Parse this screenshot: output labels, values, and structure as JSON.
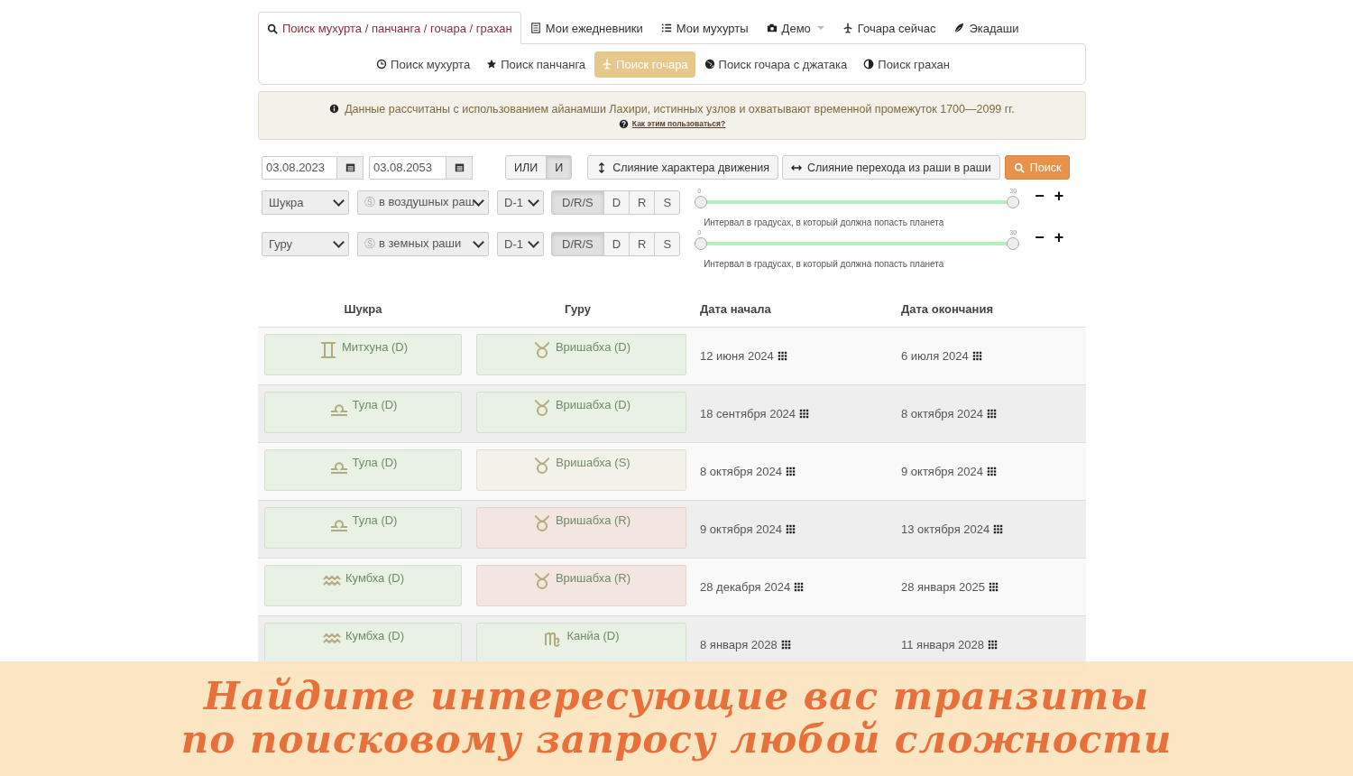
{
  "tabs": [
    {
      "label": "Поиск мухурта / панчанга / гочара / грахан",
      "selected": true
    },
    {
      "label": "Мои ежедневники",
      "selected": false
    },
    {
      "label": "Мои мухурты",
      "selected": false
    },
    {
      "label": "Демо",
      "selected": false
    },
    {
      "label": "Гочара сейчас",
      "selected": false
    },
    {
      "label": "Экадаши",
      "selected": false
    }
  ],
  "subtabs": [
    {
      "label": "Поиск мухурта",
      "selected": false
    },
    {
      "label": "Поиск панчанга",
      "selected": false
    },
    {
      "label": "Поиск гочара",
      "selected": true
    },
    {
      "label": "Поиск гочара с джатака",
      "selected": false
    },
    {
      "label": "Поиск грахан",
      "selected": false
    }
  ],
  "notice": {
    "text": "Данные рассчитаны с использованием айанамши Лахири, истинных узлов и охватывают временной промежуток 1700—2099 гг.",
    "link": "Как этим пользоваться?"
  },
  "form": {
    "date_from": "03.08.2023",
    "date_to": "03.08.2053",
    "logic": [
      {
        "label": "ИЛИ",
        "selected": false
      },
      {
        "label": "И",
        "selected": true
      }
    ],
    "merge_motion": "Слияние характера движения",
    "merge_transit": "Слияние перехода из раши в раши",
    "search": "Поиск",
    "conditions": [
      {
        "planet": "Шукра",
        "rashi_icon": "Ⓢ",
        "rashi": "в воздушных раш",
        "chart": "D-1",
        "motion": [
          {
            "label": "D/R/S",
            "selected": true
          },
          {
            "label": "D",
            "selected": false
          },
          {
            "label": "R",
            "selected": false
          },
          {
            "label": "S",
            "selected": false
          }
        ],
        "min": "0",
        "max": "30",
        "level": 1,
        "hint": "Интервал в градусах, в который должна попасть планета",
        "minus": "−",
        "plus": "+"
      },
      {
        "planet": "Гуру",
        "rashi_icon": "Ⓢ",
        "rashi": "в земных раши",
        "chart": "D-1",
        "motion": [
          {
            "label": "D/R/S",
            "selected": true
          },
          {
            "label": "D",
            "selected": false
          },
          {
            "label": "R",
            "selected": false
          },
          {
            "label": "S",
            "selected": false
          }
        ],
        "min": "0",
        "max": "30",
        "level": 1,
        "hint": "Интервал в градусах, в который должна попасть планета",
        "minus": "−",
        "plus": "+"
      }
    ]
  },
  "table": {
    "columns": [
      "Шукра",
      "Гуру",
      "Дата начала",
      "Дата окончания"
    ],
    "rows": [
      {
        "a": {
          "kind": "gemini",
          "color": "#e8f1e3",
          "label": "Митхуна (D)"
        },
        "b": {
          "kind": "taurus",
          "color": "#e8f1e3",
          "label": "Вришабха (D)"
        },
        "start": "12 июня 2024",
        "end": "6 июля 2024"
      },
      {
        "a": {
          "kind": "libra",
          "color": "#e8f1e3",
          "label": "Тула (D)"
        },
        "b": {
          "kind": "taurus",
          "color": "#e8f1e3",
          "label": "Вришабха (D)"
        },
        "start": "18 сентября 2024",
        "end": "8 октября 2024"
      },
      {
        "a": {
          "kind": "libra",
          "color": "#e8f1e3",
          "label": "Тула (D)"
        },
        "b": {
          "kind": "taurus",
          "color": "#f3f2ea",
          "label": "Вришабха (S)"
        },
        "start": "8 октября 2024",
        "end": "9 октября 2024"
      },
      {
        "a": {
          "kind": "libra",
          "color": "#e8f1e3",
          "label": "Тула (D)"
        },
        "b": {
          "kind": "taurus",
          "color": "#f3e6e0",
          "label": "Вришабха (R)"
        },
        "start": "9 октября 2024",
        "end": "13 октября 2024"
      },
      {
        "a": {
          "kind": "aquarius",
          "color": "#e8f1e3",
          "label": "Кумбха (D)"
        },
        "b": {
          "kind": "taurus",
          "color": "#f3e6e0",
          "label": "Вришабха (R)"
        },
        "start": "28 декабря 2024",
        "end": "28 января 2025"
      },
      {
        "a": {
          "kind": "aquarius",
          "color": "#e8f1e3",
          "label": "Кумбха (D)"
        },
        "b": {
          "kind": "virgo",
          "color": "#e8f1e3",
          "label": "Канйа (D)"
        },
        "start": "8 января 2028",
        "end": "11 января 2028"
      }
    ]
  },
  "banner": {
    "lines": [
      "Найдите интересующие вас транзиты",
      "по поисковому запросу любой сложности"
    ]
  }
}
